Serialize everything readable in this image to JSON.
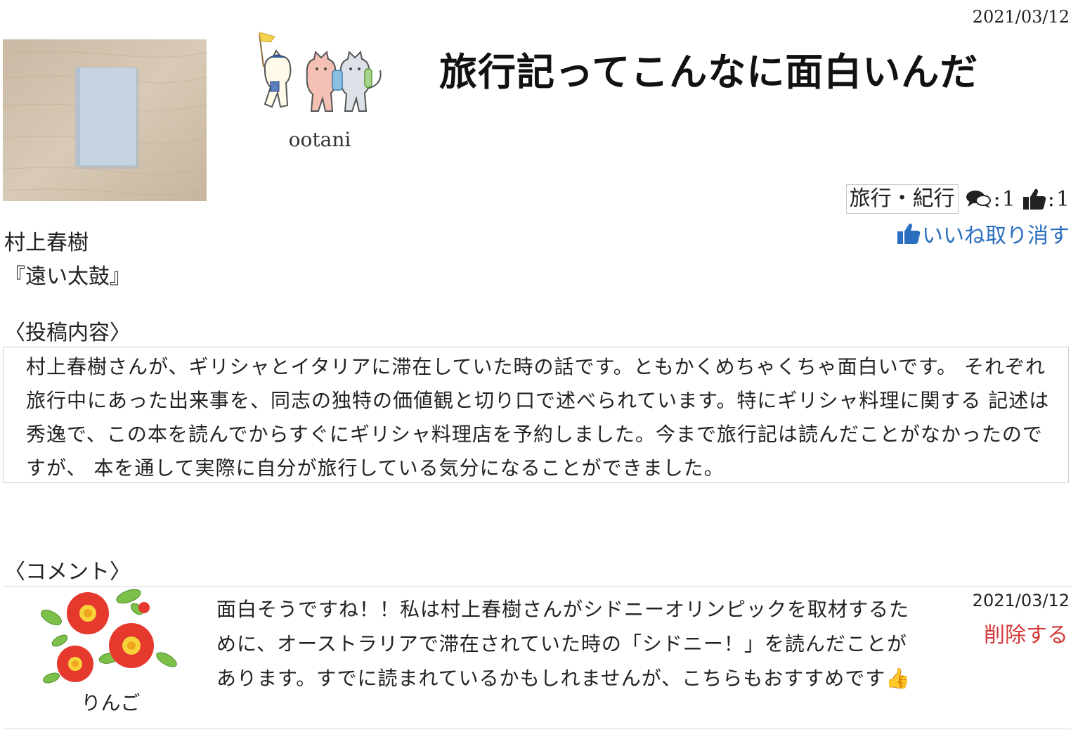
{
  "post": {
    "date": "2021/03/12",
    "title": "旅行記ってこんなに面白いんだ",
    "category": "旅行・紀行",
    "comment_count": "1",
    "like_count": "1",
    "unlike_label": "いいね取り消す",
    "author": "村上春樹",
    "book_title": "『遠い太鼓』",
    "content_heading": "〈投稿内容〉",
    "content": "村上春樹さんが、ギリシャとイタリアに滞在していた時の話です。ともかくめちゃくちゃ面白いです。 それぞれ旅行中にあった出来事を、同志の独特の価値観と切り口で述べられています。特にギリシャ料理に関する 記述は秀逸で、この本を読んでからすぐにギリシャ料理店を予約しました。今まで旅行記は読んだことがなかったのですが、 本を通して実際に自分が旅行している気分になることができました。"
  },
  "user": {
    "name": "ootani",
    "avatar_icon": "cats-with-flag-icon"
  },
  "comments_section": {
    "heading": "〈コメント〉",
    "comments": [
      {
        "user": "りんご",
        "avatar_icon": "camellia-flowers-icon",
        "text": "面白そうですね！！私は村上春樹さんがシドニーオリンピックを取材するために、オーストラリアで滞在されていた時の「シドニー！」を読んだことがあります。すでに読まれているかもしれませんが、こちらもおすすめです",
        "emoji": "👍",
        "date": "2021/03/12",
        "delete_label": "削除する"
      }
    ]
  },
  "colors": {
    "link_blue": "#2a6fbf",
    "delete_red": "#d33a3a",
    "border_gray": "#cfcfcf"
  }
}
